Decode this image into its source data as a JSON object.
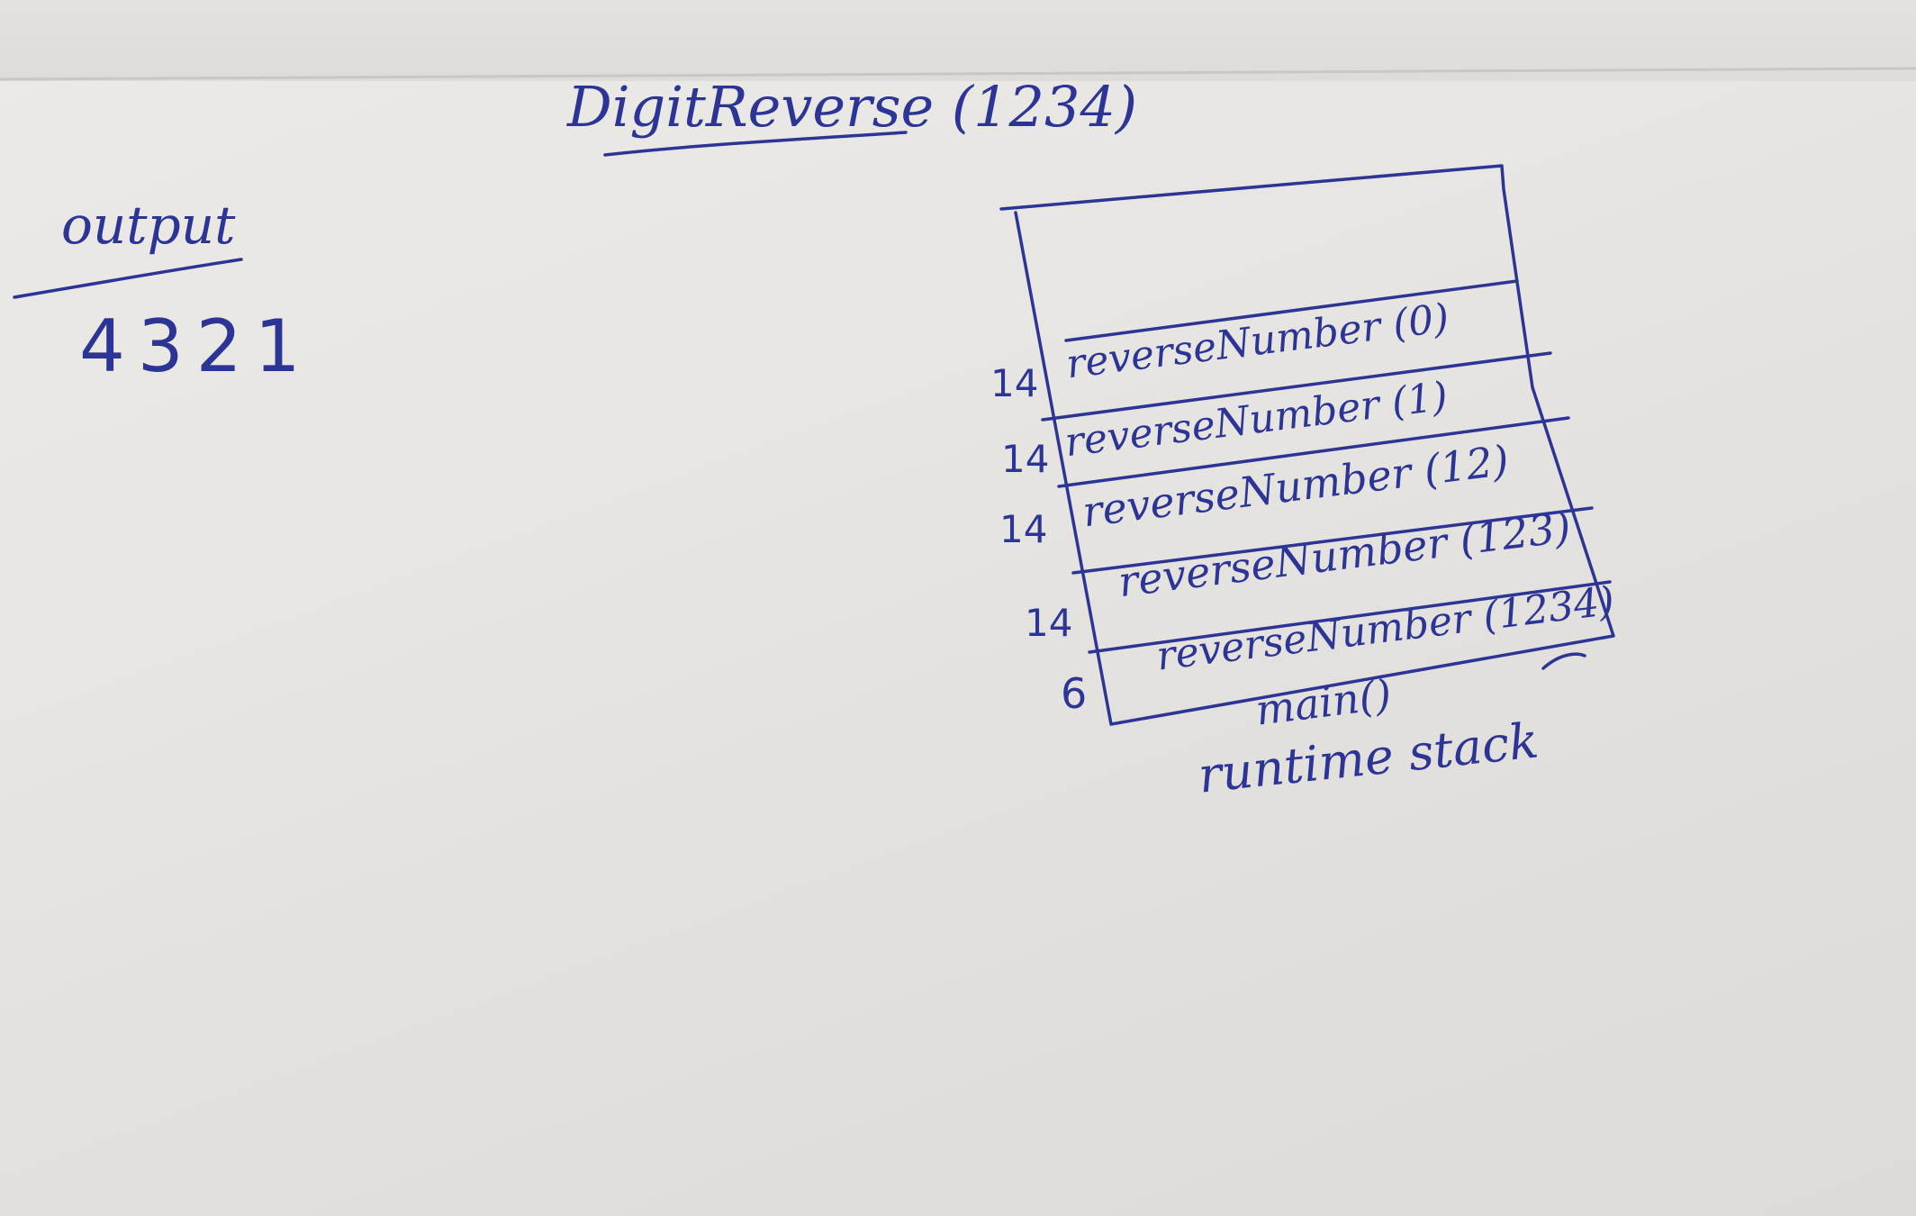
{
  "title": "DigitReverse (1234)",
  "output_label": "output",
  "output_value": "4321",
  "stack": {
    "caption": "runtime stack",
    "frames": [
      {
        "line": "",
        "label": "reverseNumber (0)"
      },
      {
        "line": "14",
        "label": "reverseNumber (1)"
      },
      {
        "line": "14",
        "label": "reverseNumber (12)"
      },
      {
        "line": "14",
        "label": "reverseNumber (123)"
      },
      {
        "line": "14",
        "label": "reverseNumber (1234)"
      },
      {
        "line": "6",
        "label": "main()"
      }
    ]
  },
  "colors": {
    "ink": "#2c3596",
    "paper": "#e8e6e2"
  }
}
